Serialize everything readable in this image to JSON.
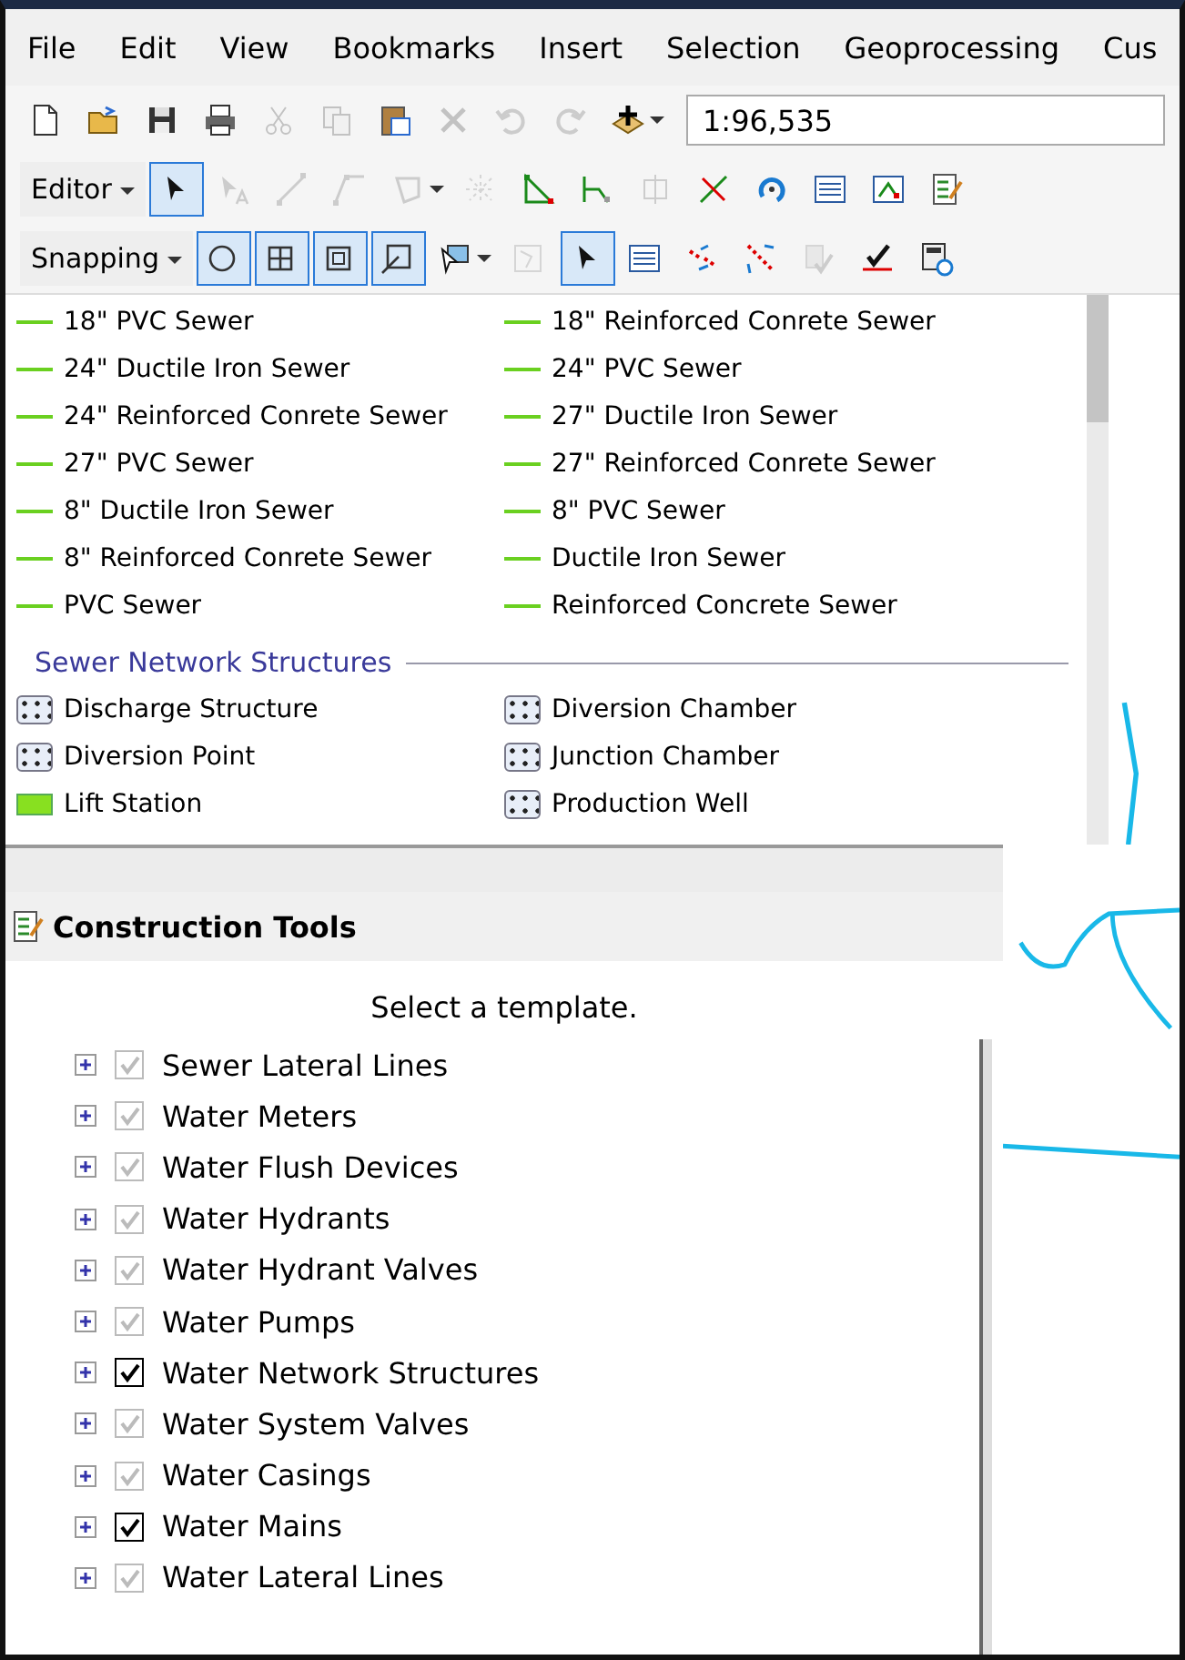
{
  "menu": [
    {
      "label": "File"
    },
    {
      "label": "Edit"
    },
    {
      "label": "View"
    },
    {
      "label": "Bookmarks"
    },
    {
      "label": "Insert"
    },
    {
      "label": "Selection"
    },
    {
      "label": "Geoprocessing"
    },
    {
      "label": "Cus"
    }
  ],
  "standard_toolbar": {
    "buttons": [
      {
        "kind": "new",
        "selected": false,
        "disabled": false
      },
      {
        "kind": "open",
        "selected": false,
        "disabled": false
      },
      {
        "kind": "save",
        "selected": false,
        "disabled": false
      },
      {
        "kind": "print",
        "selected": false,
        "disabled": false
      },
      {
        "kind": "cut",
        "selected": false,
        "disabled": true
      },
      {
        "kind": "copy",
        "selected": false,
        "disabled": true
      },
      {
        "kind": "paste",
        "selected": false,
        "disabled": false
      },
      {
        "kind": "delete",
        "selected": false,
        "disabled": true
      },
      {
        "kind": "undo",
        "selected": false,
        "disabled": true
      },
      {
        "kind": "redo",
        "selected": false,
        "disabled": true
      },
      {
        "kind": "add",
        "selected": false,
        "disabled": false,
        "caret": true
      }
    ],
    "scale": "1:96,535"
  },
  "editor_toolbar": {
    "menu": "Editor",
    "buttons": [
      {
        "kind": "pointer",
        "selected": true,
        "disabled": false
      },
      {
        "kind": "annotate",
        "selected": false,
        "disabled": true
      },
      {
        "kind": "line",
        "selected": false,
        "disabled": true
      },
      {
        "kind": "trace",
        "selected": false,
        "disabled": true
      },
      {
        "kind": "polygon",
        "selected": false,
        "disabled": true,
        "caret": true
      },
      {
        "kind": "midpoint",
        "selected": false,
        "disabled": true
      },
      {
        "kind": "vertices",
        "selected": false,
        "disabled": false
      },
      {
        "kind": "reshape",
        "selected": false,
        "disabled": false
      },
      {
        "kind": "split-box",
        "selected": false,
        "disabled": true
      },
      {
        "kind": "split",
        "selected": false,
        "disabled": false
      },
      {
        "kind": "rotate",
        "selected": false,
        "disabled": false
      },
      {
        "kind": "table",
        "selected": false,
        "disabled": false
      },
      {
        "kind": "sketch",
        "selected": false,
        "disabled": false
      },
      {
        "kind": "form",
        "selected": false,
        "disabled": false
      }
    ]
  },
  "snapping_toolbar": {
    "menu": "Snapping",
    "buttons": [
      {
        "kind": "circle",
        "selected": true,
        "disabled": false
      },
      {
        "kind": "grid",
        "selected": true,
        "disabled": false
      },
      {
        "kind": "square",
        "selected": true,
        "disabled": false
      },
      {
        "kind": "edge",
        "selected": true,
        "disabled": false
      },
      {
        "kind": "select",
        "selected": false,
        "disabled": false,
        "caret": true
      },
      {
        "kind": "topology",
        "selected": false,
        "disabled": true
      },
      {
        "kind": "pointer",
        "selected": true,
        "disabled": false
      },
      {
        "kind": "table",
        "selected": false,
        "disabled": false
      },
      {
        "kind": "swap",
        "selected": false,
        "disabled": false
      },
      {
        "kind": "stretch",
        "selected": false,
        "disabled": false
      },
      {
        "kind": "validate",
        "selected": false,
        "disabled": true
      },
      {
        "kind": "fix",
        "selected": false,
        "disabled": false
      },
      {
        "kind": "calc",
        "selected": false,
        "disabled": false
      }
    ]
  },
  "templates": {
    "items": [
      {
        "label": "18\" PVC Sewer",
        "kind": "line"
      },
      {
        "label": "18\" Reinforced Conrete Sewer",
        "kind": "line"
      },
      {
        "label": "24\" Ductile Iron Sewer",
        "kind": "line"
      },
      {
        "label": "24\" PVC Sewer",
        "kind": "line"
      },
      {
        "label": "24\" Reinforced Conrete Sewer",
        "kind": "line"
      },
      {
        "label": "27\" Ductile Iron Sewer",
        "kind": "line"
      },
      {
        "label": "27\" PVC Sewer",
        "kind": "line"
      },
      {
        "label": "27\" Reinforced Conrete Sewer",
        "kind": "line"
      },
      {
        "label": "8\" Ductile Iron Sewer",
        "kind": "line"
      },
      {
        "label": "8\" PVC Sewer",
        "kind": "line"
      },
      {
        "label": "8\" Reinforced Conrete Sewer",
        "kind": "line"
      },
      {
        "label": "Ductile Iron Sewer",
        "kind": "line"
      },
      {
        "label": "PVC Sewer",
        "kind": "line"
      },
      {
        "label": "Reinforced Concrete Sewer",
        "kind": "line"
      }
    ],
    "section": {
      "title": "Sewer Network Structures",
      "items": [
        {
          "label": "Discharge Structure",
          "kind": "point"
        },
        {
          "label": "Diversion Chamber",
          "kind": "point"
        },
        {
          "label": "Diversion Point",
          "kind": "point"
        },
        {
          "label": "Junction Chamber",
          "kind": "point"
        },
        {
          "label": "Lift Station",
          "kind": "station"
        },
        {
          "label": "Production Well",
          "kind": "point"
        }
      ]
    }
  },
  "construction_tools": {
    "title": "Construction Tools",
    "message": "Select a template.",
    "layers": [
      {
        "label": "Sewer Lateral Lines",
        "checked": true,
        "disabled": true
      },
      {
        "label": "Water Meters",
        "checked": true,
        "disabled": true
      },
      {
        "label": "Water Flush Devices",
        "checked": true,
        "disabled": true
      },
      {
        "label": "Water Hydrants",
        "checked": true,
        "disabled": true
      },
      {
        "label": "Water Hydrant Valves",
        "checked": true,
        "disabled": true
      },
      {
        "label": "Water Pumps",
        "checked": true,
        "disabled": true
      },
      {
        "label": "Water Network Structures",
        "checked": true,
        "disabled": false
      },
      {
        "label": "Water System Valves",
        "checked": true,
        "disabled": true
      },
      {
        "label": "Water Casings",
        "checked": true,
        "disabled": true
      },
      {
        "label": "Water Mains",
        "checked": true,
        "disabled": false
      },
      {
        "label": "Water Lateral Lines",
        "checked": true,
        "disabled": true
      }
    ]
  }
}
